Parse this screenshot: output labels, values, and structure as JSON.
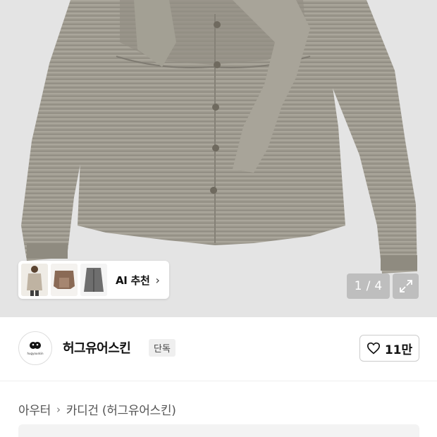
{
  "hero": {
    "image_alt": "gray striped cardigan with ruched bow front",
    "counter_current": "1",
    "counter_sep": "/",
    "counter_total": "4",
    "background": "#e4e4e4",
    "garment_color": "#9b978b"
  },
  "ai_recommend": {
    "label": "AI 추천",
    "thumbnails": [
      "model-in-cardigan",
      "brown-knit-top",
      "gray-cardigan"
    ]
  },
  "brand": {
    "logo_text": "hugyouskin",
    "name": "허그유어스킨",
    "badge": "단독",
    "like_count": "11만"
  },
  "breadcrumb": {
    "items": [
      "아우터",
      "카디건 (허그유어스킨)"
    ]
  },
  "icons": {
    "expand": "expand-icon",
    "heart": "heart-icon",
    "chevron": "chevron-right-icon"
  }
}
